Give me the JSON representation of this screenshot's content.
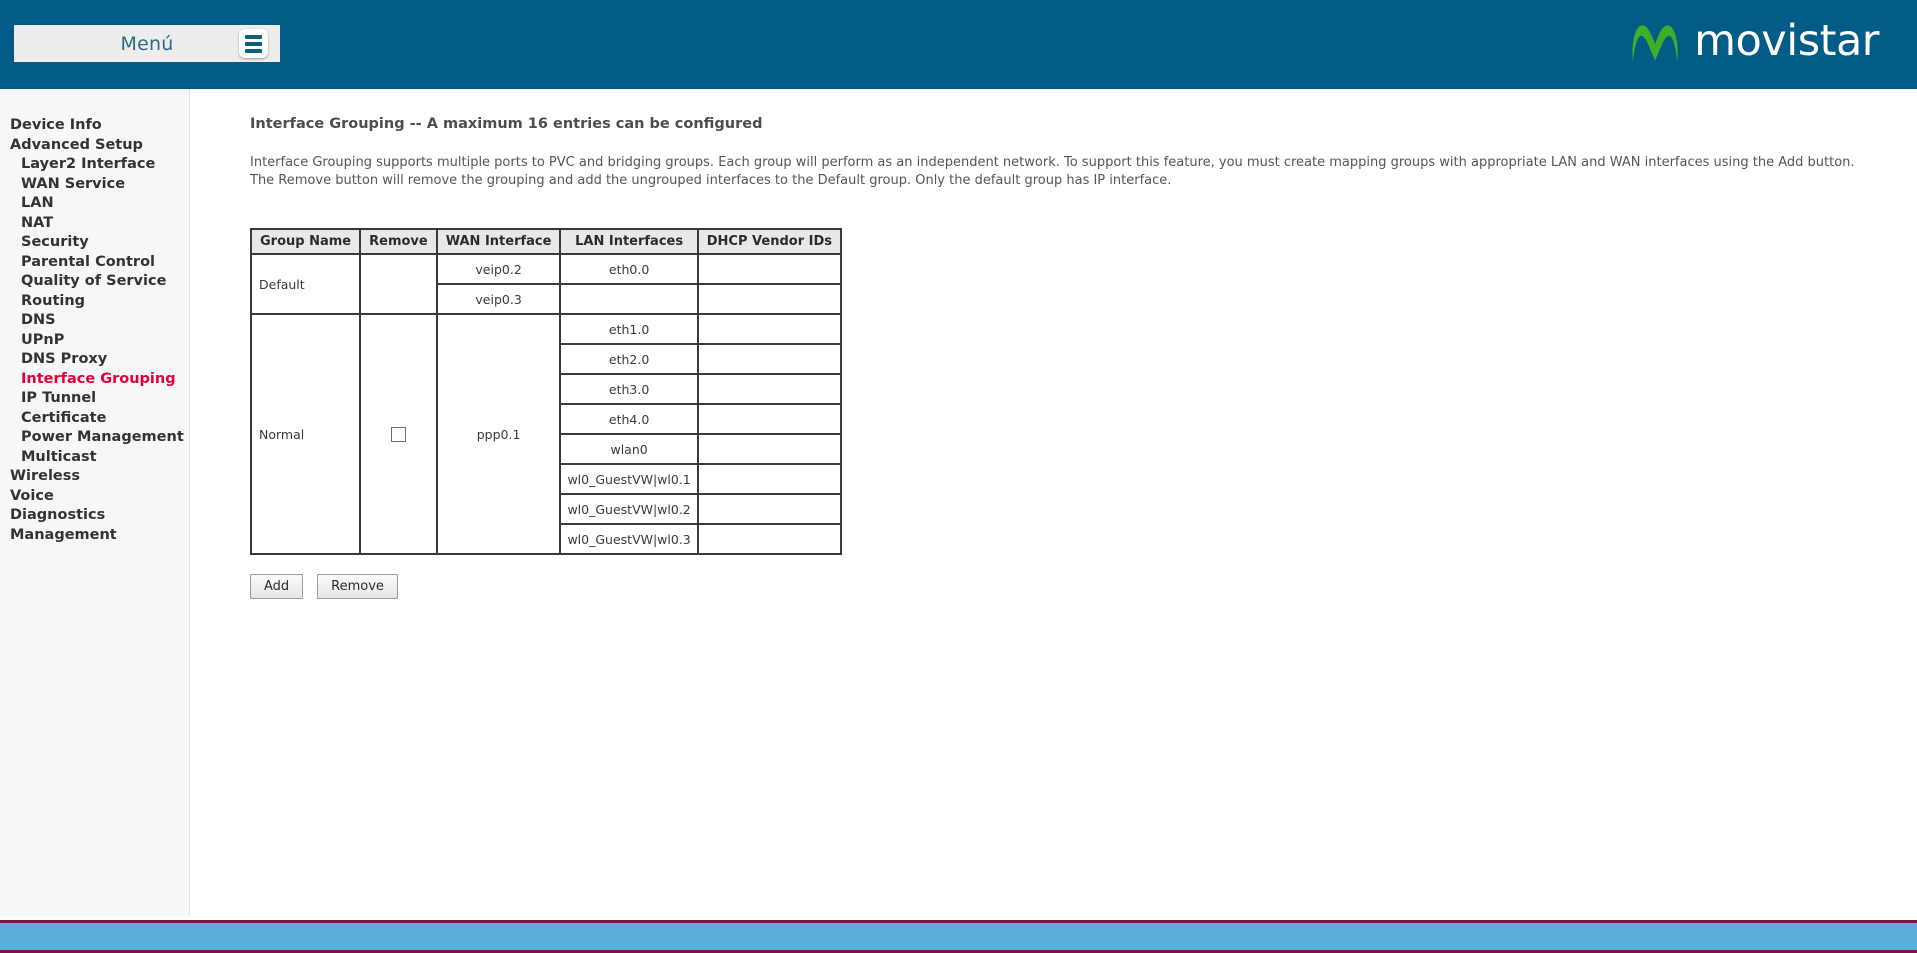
{
  "header": {
    "menu_label": "Menú",
    "menu_icon": "hamburger-icon",
    "brand_name": "movistar",
    "brand_mark_icon": "movistar-m-logo",
    "background_color": "#015C87",
    "brand_green": "#3FAE2A"
  },
  "sidebar": {
    "items": [
      {
        "label": "Device Info",
        "level": 0,
        "active": false
      },
      {
        "label": "Advanced Setup",
        "level": 0,
        "active": false
      },
      {
        "label": "Layer2 Interface",
        "level": 1,
        "active": false
      },
      {
        "label": "WAN Service",
        "level": 1,
        "active": false
      },
      {
        "label": "LAN",
        "level": 1,
        "active": false
      },
      {
        "label": "NAT",
        "level": 1,
        "active": false
      },
      {
        "label": "Security",
        "level": 1,
        "active": false
      },
      {
        "label": "Parental Control",
        "level": 1,
        "active": false
      },
      {
        "label": "Quality of Service",
        "level": 1,
        "active": false
      },
      {
        "label": "Routing",
        "level": 1,
        "active": false
      },
      {
        "label": "DNS",
        "level": 1,
        "active": false
      },
      {
        "label": "UPnP",
        "level": 1,
        "active": false
      },
      {
        "label": "DNS Proxy",
        "level": 1,
        "active": false
      },
      {
        "label": "Interface Grouping",
        "level": 1,
        "active": true
      },
      {
        "label": "IP Tunnel",
        "level": 1,
        "active": false
      },
      {
        "label": "Certificate",
        "level": 1,
        "active": false
      },
      {
        "label": "Power Management",
        "level": 1,
        "active": false
      },
      {
        "label": "Multicast",
        "level": 1,
        "active": false
      },
      {
        "label": "Wireless",
        "level": 0,
        "active": false
      },
      {
        "label": "Voice",
        "level": 0,
        "active": false
      },
      {
        "label": "Diagnostics",
        "level": 0,
        "active": false
      },
      {
        "label": "Management",
        "level": 0,
        "active": false
      }
    ],
    "active_color": "#E3003A"
  },
  "main": {
    "title": "Interface Grouping -- A maximum 16 entries can be configured",
    "description": "Interface Grouping supports multiple ports to PVC and bridging groups. Each group will perform as an independent network. To support this feature, you must create mapping groups with appropriate LAN and WAN interfaces using the Add button. The Remove button will remove the grouping and add the ungrouped interfaces to the Default group. Only the default group has IP interface.",
    "table": {
      "columns": [
        "Group Name",
        "Remove",
        "WAN Interface",
        "LAN Interfaces",
        "DHCP Vendor IDs"
      ],
      "groups": [
        {
          "name": "Default",
          "removable": false,
          "rows": [
            {
              "wan": "veip0.2",
              "lan": "eth0.0",
              "dhcp": ""
            },
            {
              "wan": "veip0.3",
              "lan": "",
              "dhcp": ""
            }
          ]
        },
        {
          "name": "Normal",
          "removable": true,
          "remove_checked": false,
          "wan": "ppp0.1",
          "rows": [
            {
              "lan": "eth1.0",
              "dhcp": ""
            },
            {
              "lan": "eth2.0",
              "dhcp": ""
            },
            {
              "lan": "eth3.0",
              "dhcp": ""
            },
            {
              "lan": "eth4.0",
              "dhcp": ""
            },
            {
              "lan": "wlan0",
              "dhcp": ""
            },
            {
              "lan": "wl0_GuestVW|wl0.1",
              "dhcp": ""
            },
            {
              "lan": "wl0_GuestVW|wl0.2",
              "dhcp": ""
            },
            {
              "lan": "wl0_GuestVW|wl0.3",
              "dhcp": ""
            }
          ]
        }
      ]
    },
    "buttons": {
      "add_label": "Add",
      "remove_label": "Remove"
    }
  },
  "footer": {
    "background_color": "#5BAEDC",
    "border_color": "#7B1440"
  }
}
